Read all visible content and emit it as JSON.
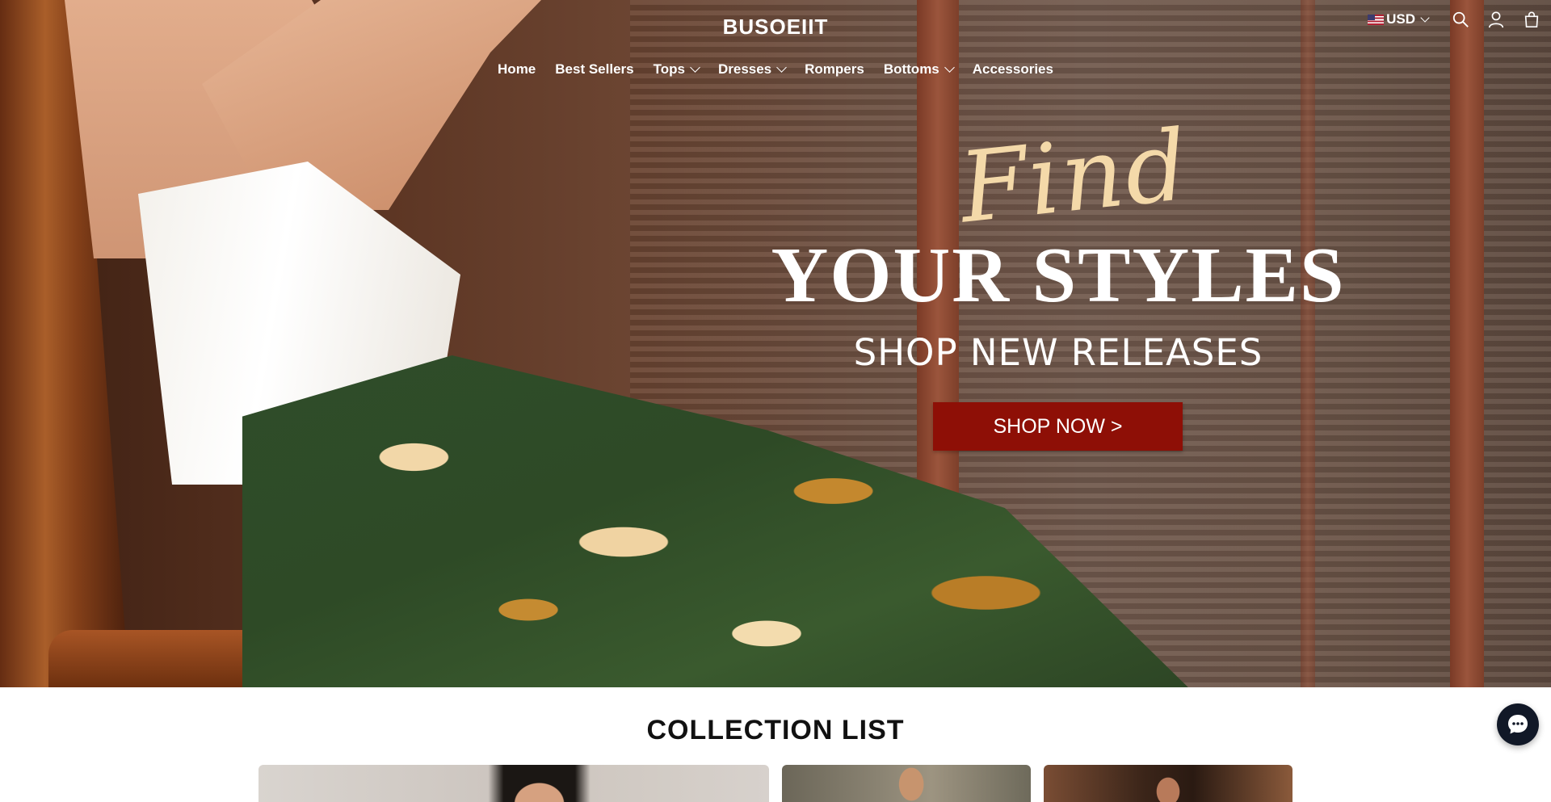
{
  "header": {
    "logo": "BUSOEIIT",
    "currency": "USD",
    "nav": [
      {
        "label": "Home"
      },
      {
        "label": "Best Sellers"
      },
      {
        "label": "Tops"
      },
      {
        "label": "Dresses"
      },
      {
        "label": "Rompers"
      },
      {
        "label": "Bottoms"
      },
      {
        "label": "Accessories"
      }
    ]
  },
  "hero": {
    "script": "Find",
    "headline": "YOUR STYLES",
    "subheadline": "SHOP NEW RELEASES",
    "cta": "SHOP NOW >"
  },
  "collection": {
    "title": "COLLECTION LIST"
  },
  "icons": {
    "search": "search-icon",
    "account": "account-icon",
    "cart": "cart-icon",
    "chat": "chat-icon",
    "flag": "us-flag-icon"
  },
  "colors": {
    "cta_background": "#8e0f06",
    "script_color": "#f4d9a9",
    "chat_button": "#111827"
  }
}
